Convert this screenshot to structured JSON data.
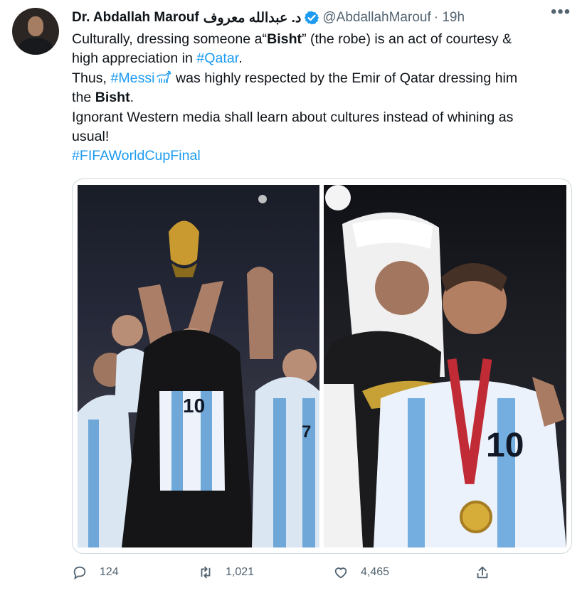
{
  "tweet": {
    "author": {
      "name": "Dr. Abdallah Marouf",
      "arabic_name": "د. عبدالله معروف",
      "handle": "@AbdallahMarouf",
      "time": "· 19h"
    },
    "text": {
      "line1_prefix": "Culturally, dressing someone a“",
      "line1_bold": "Bisht",
      "line1_suffix": "” (the robe) is an act of courtesy &",
      "line2_prefix": "high appreciation in ",
      "line2_link": "#Qatar",
      "line2_suffix": ".",
      "line3_prefix": "Thus, ",
      "line3_link": "#Messi",
      "line3_suffix": " was highly respected by the Emir of Qatar dressing him",
      "line4_prefix": "the ",
      "line4_bold": "Bisht",
      "line4_suffix": ".",
      "line5": "Ignorant Western media shall learn about cultures instead of whining as",
      "line6": "usual!",
      "hashtag": "#FIFAWorldCupFinal"
    },
    "media": {
      "left_photo_numbers": [
        "10",
        "7"
      ],
      "right_photo_number": "10"
    },
    "metrics": {
      "replies": "124",
      "retweets": "1,021",
      "likes": "4,465"
    },
    "colors": {
      "link": "#1d9bf0",
      "verified": "#1d9bf0",
      "secondary_text": "#536471"
    },
    "icons": {
      "verified": "verified-badge-icon",
      "more": "more-options-icon",
      "reply": "reply-icon",
      "retweet": "retweet-icon",
      "like": "heart-icon",
      "share": "share-icon",
      "emoji": "goat-emoji-icon"
    }
  }
}
